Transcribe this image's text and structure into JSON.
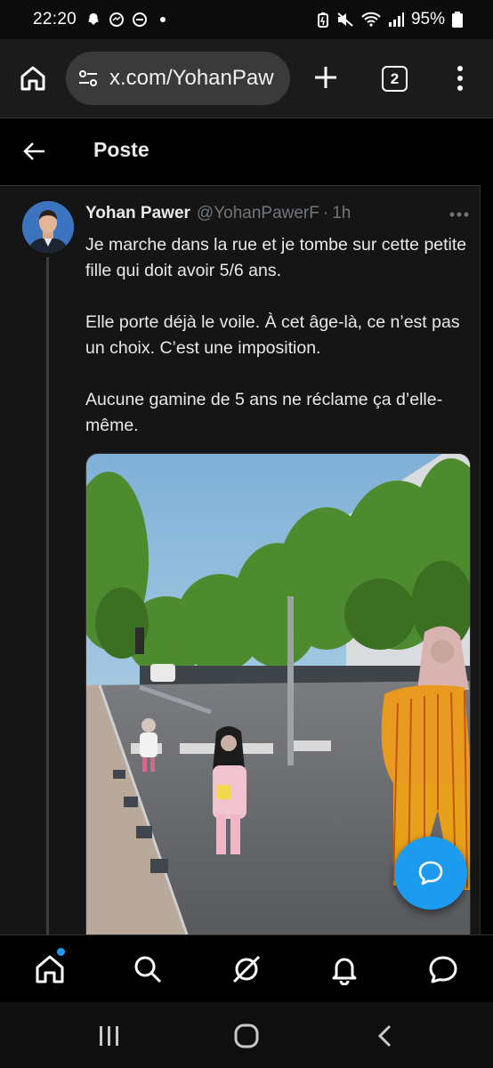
{
  "status_bar": {
    "time": "22:20",
    "battery": "95%",
    "left_icons": [
      "snapchat-icon",
      "messenger-icon",
      "dnd-icon",
      "dot-icon"
    ],
    "right_icons": [
      "battery-saver-icon",
      "mute-icon",
      "wifi-icon",
      "signal-icon",
      "battery-icon"
    ]
  },
  "browser": {
    "url": "x.com/YohanPaw",
    "tab_count": "2"
  },
  "header": {
    "title": "Poste"
  },
  "tweet": {
    "author_name": "Yohan Pawer",
    "author_handle": "@YohanPawerF",
    "separator": "·",
    "time": "1h",
    "paragraphs": [
      "Je marche dans la rue et je tombe sur cette petite fille qui doit avoir 5/6 ans.",
      "Elle porte déjà le voile. À cet âge-là, ce n’est pas un choix. C’est une imposition.",
      "Aucune gamine de 5 ans ne réclame ça d’elle-même."
    ]
  },
  "bottom_nav": [
    "home-icon",
    "search-icon",
    "grok-icon",
    "notifications-icon",
    "messages-icon"
  ],
  "colors": {
    "accent": "#1d9bf0",
    "background": "#000000",
    "card": "#151515",
    "text": "#e7e9ea",
    "muted": "#71767b"
  }
}
